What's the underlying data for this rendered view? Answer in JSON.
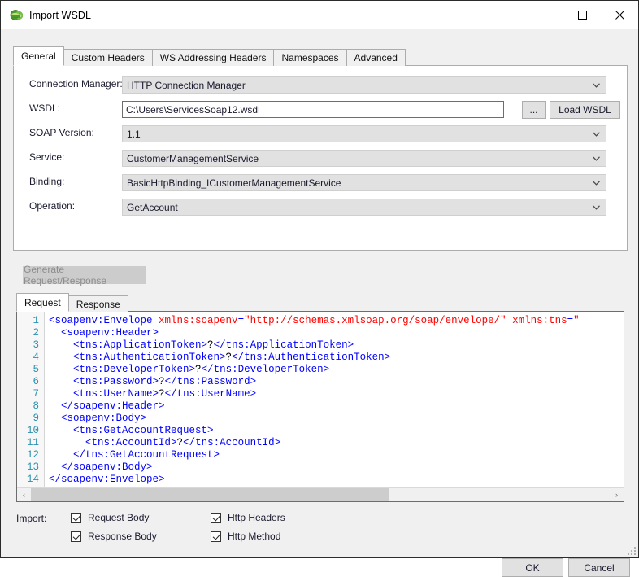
{
  "window": {
    "title": "Import WSDL",
    "icon": "globe-refresh-icon",
    "minimize": "—",
    "maximize": "☐",
    "close": "✕"
  },
  "tabs": [
    {
      "label": "General",
      "active": true
    },
    {
      "label": "Custom Headers",
      "active": false
    },
    {
      "label": "WS Addressing Headers",
      "active": false
    },
    {
      "label": "Namespaces",
      "active": false
    },
    {
      "label": "Advanced",
      "active": false
    }
  ],
  "form": {
    "connection_manager": {
      "label": "Connection Manager:",
      "value": "HTTP Connection Manager"
    },
    "wsdl": {
      "label": "WSDL:",
      "value": "C:\\Users\\ServicesSoap12.wsdl"
    },
    "browse_button": "...",
    "load_button": "Load WSDL",
    "soap_version": {
      "label": "SOAP Version:",
      "value": "1.1"
    },
    "service": {
      "label": "Service:",
      "value": "CustomerManagementService"
    },
    "binding": {
      "label": "Binding:",
      "value": "BasicHttpBinding_ICustomerManagementService"
    },
    "operation": {
      "label": "Operation:",
      "value": "GetAccount"
    }
  },
  "generate_button": {
    "label": "Generate Request/Response",
    "enabled": false
  },
  "subtabs": [
    {
      "label": "Request",
      "active": true
    },
    {
      "label": "Response",
      "active": false
    }
  ],
  "editor": {
    "line_numbers": [
      "1",
      "2",
      "3",
      "4",
      "5",
      "6",
      "7",
      "8",
      "9",
      "10",
      "11",
      "12",
      "13",
      "14"
    ],
    "lines": [
      {
        "n": 1,
        "indent": 0,
        "segments": [
          {
            "t": "tg",
            "s": "<soapenv:Envelope "
          },
          {
            "t": "at",
            "s": "xmlns:soapenv"
          },
          {
            "t": "eq",
            "s": "="
          },
          {
            "t": "st",
            "s": "\"http://schemas.xmlsoap.org/soap/envelope/\" "
          },
          {
            "t": "at",
            "s": "xmlns:tns"
          },
          {
            "t": "eq",
            "s": "="
          },
          {
            "t": "st",
            "s": "\""
          }
        ]
      },
      {
        "n": 2,
        "indent": 1,
        "segments": [
          {
            "t": "tg",
            "s": "<soapenv:Header>"
          }
        ]
      },
      {
        "n": 3,
        "indent": 2,
        "segments": [
          {
            "t": "tg",
            "s": "<tns:ApplicationToken>"
          },
          {
            "t": "tx",
            "s": "?"
          },
          {
            "t": "tg",
            "s": "</tns:ApplicationToken>"
          }
        ]
      },
      {
        "n": 4,
        "indent": 2,
        "segments": [
          {
            "t": "tg",
            "s": "<tns:AuthenticationToken>"
          },
          {
            "t": "tx",
            "s": "?"
          },
          {
            "t": "tg",
            "s": "</tns:AuthenticationToken>"
          }
        ]
      },
      {
        "n": 5,
        "indent": 2,
        "segments": [
          {
            "t": "tg",
            "s": "<tns:DeveloperToken>"
          },
          {
            "t": "tx",
            "s": "?"
          },
          {
            "t": "tg",
            "s": "</tns:DeveloperToken>"
          }
        ]
      },
      {
        "n": 6,
        "indent": 2,
        "segments": [
          {
            "t": "tg",
            "s": "<tns:Password>"
          },
          {
            "t": "tx",
            "s": "?"
          },
          {
            "t": "tg",
            "s": "</tns:Password>"
          }
        ]
      },
      {
        "n": 7,
        "indent": 2,
        "segments": [
          {
            "t": "tg",
            "s": "<tns:UserName>"
          },
          {
            "t": "tx",
            "s": "?"
          },
          {
            "t": "tg",
            "s": "</tns:UserName>"
          }
        ]
      },
      {
        "n": 8,
        "indent": 1,
        "segments": [
          {
            "t": "tg",
            "s": "</soapenv:Header>"
          }
        ]
      },
      {
        "n": 9,
        "indent": 1,
        "segments": [
          {
            "t": "tg",
            "s": "<soapenv:Body>"
          }
        ]
      },
      {
        "n": 10,
        "indent": 2,
        "segments": [
          {
            "t": "tg",
            "s": "<tns:GetAccountRequest>"
          }
        ]
      },
      {
        "n": 11,
        "indent": 3,
        "segments": [
          {
            "t": "tg",
            "s": "<tns:AccountId>"
          },
          {
            "t": "tx",
            "s": "?"
          },
          {
            "t": "tg",
            "s": "</tns:AccountId>"
          }
        ]
      },
      {
        "n": 12,
        "indent": 2,
        "segments": [
          {
            "t": "tg",
            "s": "</tns:GetAccountRequest>"
          }
        ]
      },
      {
        "n": 13,
        "indent": 1,
        "segments": [
          {
            "t": "tg",
            "s": "</soapenv:Body>"
          }
        ]
      },
      {
        "n": 14,
        "indent": 0,
        "segments": [
          {
            "t": "tg",
            "s": "</soapenv:Envelope>"
          }
        ]
      }
    ],
    "hscroll": {
      "left_arrow": "‹",
      "right_arrow": "›",
      "thumb_percent": 62
    }
  },
  "import": {
    "label": "Import:",
    "options": [
      {
        "label": "Request Body",
        "checked": true,
        "col": 0,
        "row": 0
      },
      {
        "label": "Response Body",
        "checked": true,
        "col": 0,
        "row": 1
      },
      {
        "label": "Http Headers",
        "checked": true,
        "col": 1,
        "row": 0
      },
      {
        "label": "Http Method",
        "checked": true,
        "col": 1,
        "row": 1
      }
    ]
  },
  "footer": {
    "ok_label": "OK",
    "cancel_label": "Cancel"
  },
  "colors": {
    "dialog_bg": "#f0f0f0",
    "panel_bg": "#ffffff",
    "combo_bg": "#e1e1e1",
    "tag": "#0000ff",
    "attribute": "#ff0000",
    "line_number": "#2b91af",
    "disabled_text": "#8d8d8d"
  }
}
